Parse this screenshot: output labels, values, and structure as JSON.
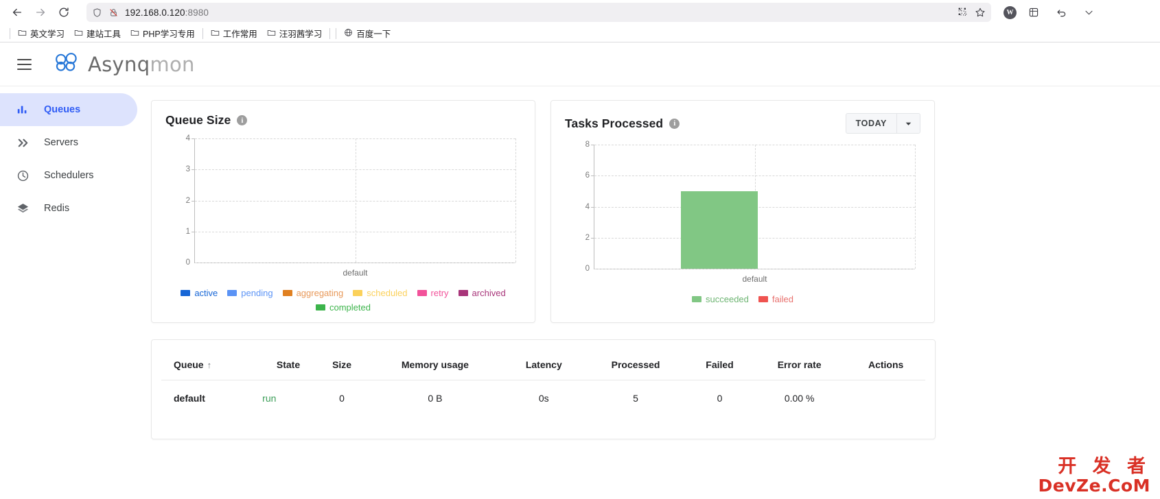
{
  "browser": {
    "back_label": "Back",
    "forward_label": "Forward",
    "reload_label": "Reload",
    "url_host": "192.168.0.120",
    "url_port": ":8980",
    "shield_icon": "shield-icon",
    "tracking_icon": "tracking-protection-off-icon",
    "qr_icon": "qr-code-icon",
    "bookmark_star_icon": "star-icon",
    "profile_initial": "W",
    "extension_icon": "extensions-icon",
    "undo_icon": "undo-icon",
    "menu_caret_icon": "chevron-down-icon"
  },
  "bookmarks": [
    {
      "label": "英文学习",
      "icon": "folder-icon"
    },
    {
      "label": "建站工具",
      "icon": "folder-icon"
    },
    {
      "label": "PHP学习专用",
      "icon": "folder-icon"
    },
    {
      "label": "工作常用",
      "icon": "folder-icon"
    },
    {
      "label": "汪羽茜学习",
      "icon": "folder-icon"
    },
    {
      "label": "百度一下",
      "icon": "globe-icon"
    }
  ],
  "app": {
    "menu_icon": "hamburger-menu-icon",
    "logo_icon": "asynqmon-logo-icon",
    "brand_primary": "Asynq",
    "brand_secondary": "mon"
  },
  "sidebar": {
    "items": [
      {
        "label": "Queues",
        "icon": "bar-chart-icon",
        "active": true
      },
      {
        "label": "Servers",
        "icon": "chevron-double-right-icon",
        "active": false
      },
      {
        "label": "Schedulers",
        "icon": "clock-icon",
        "active": false
      },
      {
        "label": "Redis",
        "icon": "layers-icon",
        "active": false
      }
    ]
  },
  "queue_size_card": {
    "title": "Queue Size",
    "info_icon": "info-icon",
    "info_char": "i"
  },
  "tasks_processed_card": {
    "title": "Tasks Processed",
    "info_icon": "info-icon",
    "info_char": "i",
    "range_label": "TODAY",
    "caret_icon": "chevron-down-icon"
  },
  "table": {
    "headers": [
      "Queue",
      "State",
      "Size",
      "Memory usage",
      "Latency",
      "Processed",
      "Failed",
      "Error rate",
      "Actions"
    ],
    "sort_arrow": "↑",
    "rows": [
      {
        "queue": "default",
        "state": "run",
        "size": "0",
        "memory_usage": "0 B",
        "latency": "0s",
        "processed": "5",
        "failed": "0",
        "error_rate": "0.00 %",
        "actions": ""
      }
    ]
  },
  "watermark": {
    "line1": "开 发 者",
    "line2": "DevZe.CoM"
  },
  "chart_data": [
    {
      "type": "bar",
      "title": "Queue Size",
      "categories": [
        "default"
      ],
      "xlabel": "",
      "ylabel": "",
      "ylim": [
        0,
        4
      ],
      "yticks": [
        0,
        1,
        2,
        3,
        4
      ],
      "grid": true,
      "legend_position": "bottom",
      "series": [
        {
          "name": "active",
          "color": "#1766d6",
          "values": [
            0
          ]
        },
        {
          "name": "pending",
          "color": "#5b93f5",
          "values": [
            0
          ]
        },
        {
          "name": "aggregating",
          "color": "#e08021",
          "values": [
            0
          ]
        },
        {
          "name": "scheduled",
          "color": "#fbd15b",
          "values": [
            0
          ]
        },
        {
          "name": "retry",
          "color": "#f2529a",
          "values": [
            0
          ]
        },
        {
          "name": "archived",
          "color": "#a8357a",
          "values": [
            0
          ]
        },
        {
          "name": "completed",
          "color": "#3cb44b",
          "values": [
            0
          ]
        }
      ]
    },
    {
      "type": "bar",
      "title": "Tasks Processed",
      "categories": [
        "default"
      ],
      "xlabel": "",
      "ylabel": "",
      "ylim": [
        0,
        8
      ],
      "yticks": [
        0,
        2,
        4,
        6,
        8
      ],
      "grid": true,
      "legend_position": "bottom",
      "series": [
        {
          "name": "succeeded",
          "color": "#81c784",
          "values": [
            5
          ]
        },
        {
          "name": "failed",
          "color": "#ef5350",
          "values": [
            0
          ]
        }
      ]
    }
  ]
}
